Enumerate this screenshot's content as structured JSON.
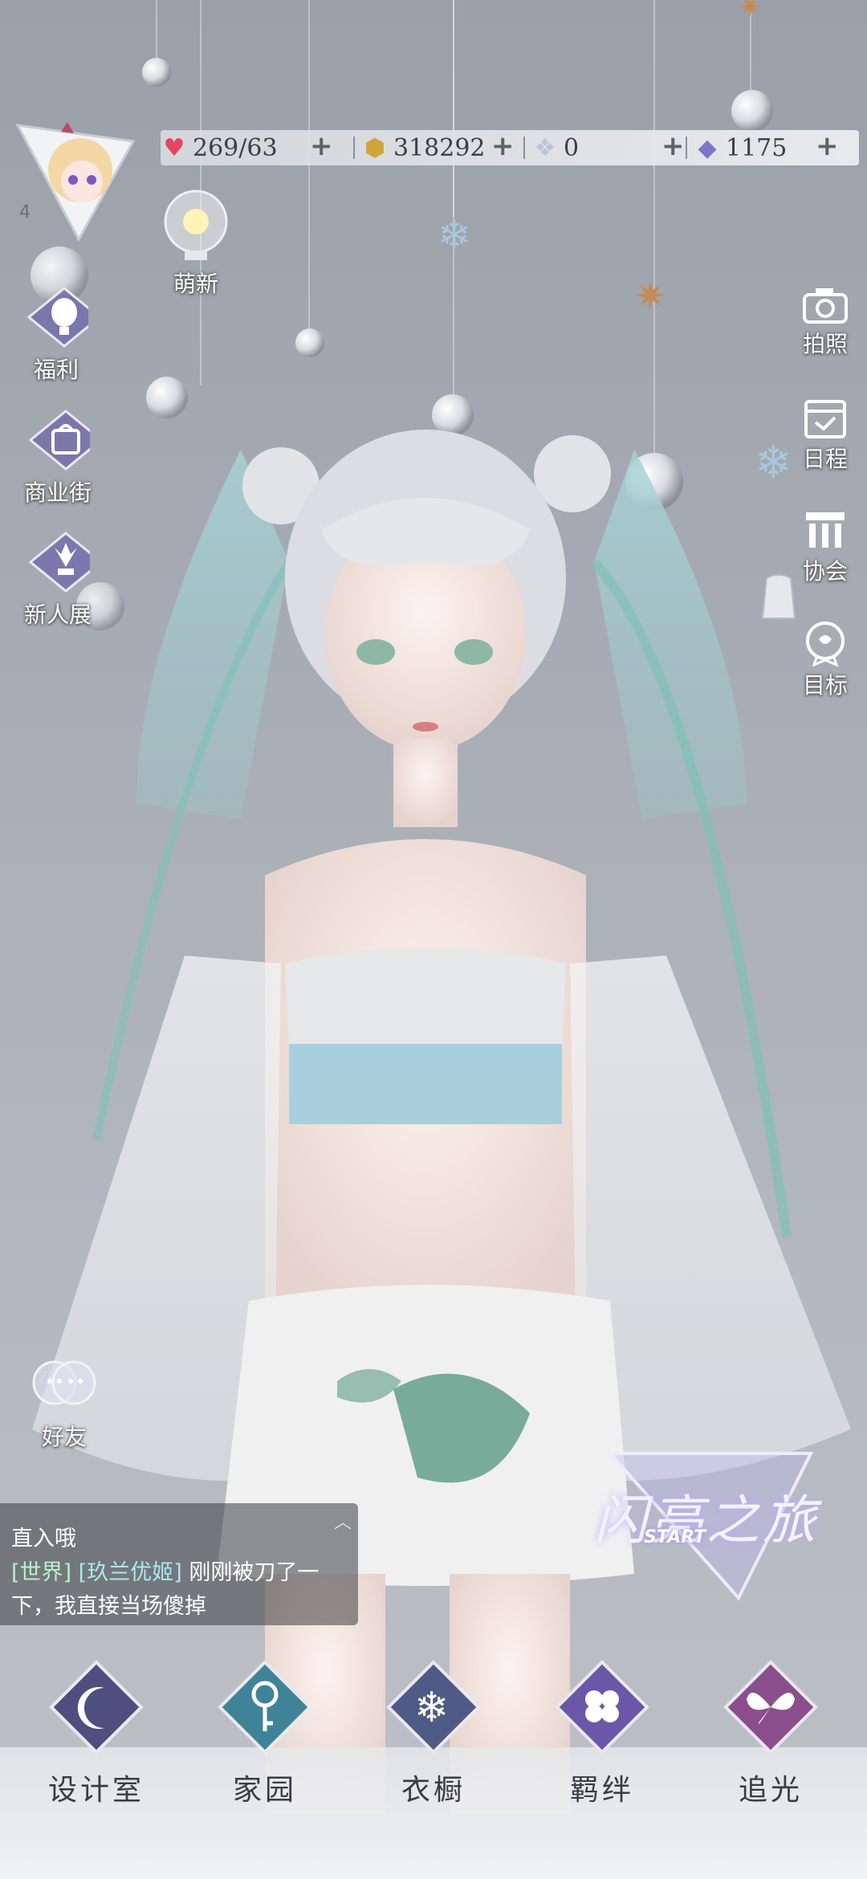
{
  "player": {
    "level": "4"
  },
  "resources": {
    "stamina": "269/63",
    "gold": "318292",
    "crystal": "0",
    "diamond": "1175"
  },
  "left_menu": {
    "newbie": "萌新",
    "welfare": "福利",
    "shop_street": "商业街",
    "newbie_show": "新人展",
    "friends": "好友"
  },
  "right_menu": {
    "photo": "拍照",
    "schedule": "日程",
    "guild": "协会",
    "goals": "目标"
  },
  "chat": {
    "line0": "直入哦",
    "line1_channel": "[世界]",
    "line1_name": "[玖兰优姬]",
    "line1_text": "刚刚被刀了一",
    "line2": "下，我直接当场傻掉"
  },
  "banner": {
    "title": "闪亮之旅",
    "subtitle": "START"
  },
  "bottom_nav": {
    "design": "设计室",
    "home": "家园",
    "wardrobe": "衣橱",
    "bond": "羁绊",
    "chase": "追光"
  },
  "colors": {
    "accent": "#8f7cf0",
    "panel": "#e9eaee",
    "text_dark": "#3a3c42"
  }
}
